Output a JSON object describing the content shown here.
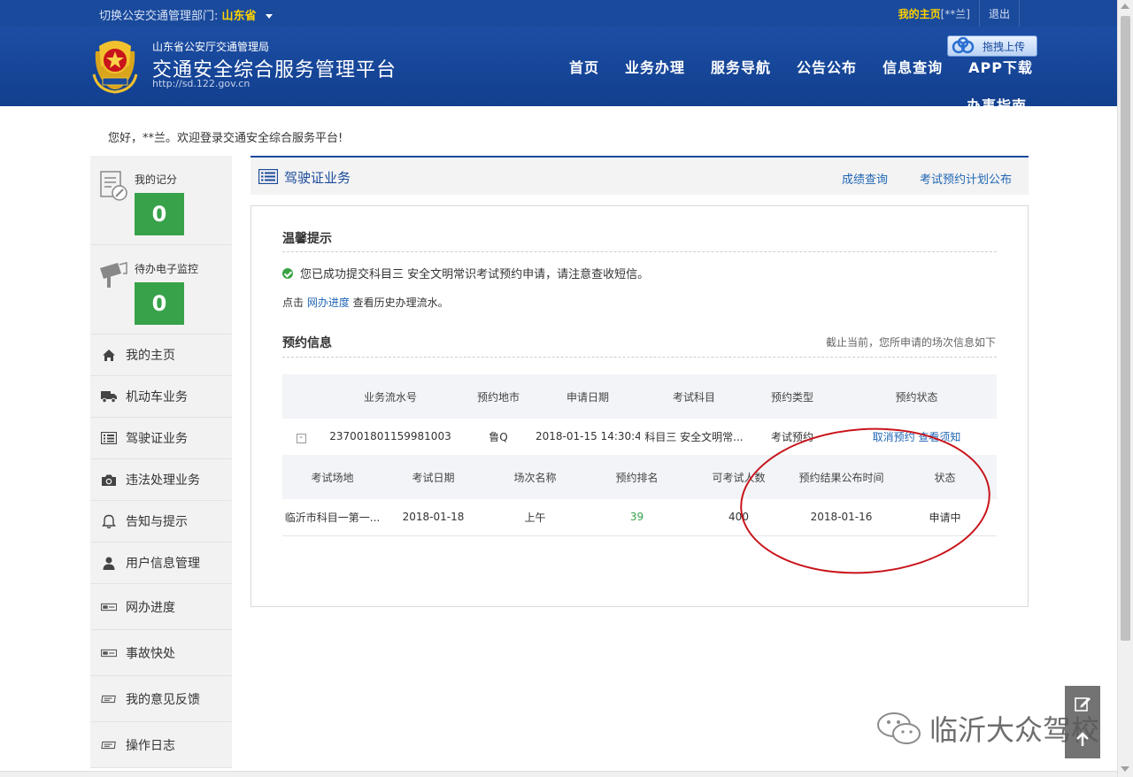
{
  "topbar": {
    "switch_label": "切换公安交通管理部门:",
    "province": "山东省",
    "home_link": "我的主页",
    "user": "[**兰]",
    "logout": "退出"
  },
  "header": {
    "org": "山东省公安厅交通管理局",
    "title": "交通安全综合服务管理平台",
    "url": "http://sd.122.gov.cn",
    "upload": "拖拽上传",
    "nav": [
      "首页",
      "业务办理",
      "服务导航",
      "公告公布",
      "信息查询",
      "APP下载"
    ],
    "nav_overflow": "办事指南"
  },
  "greeting": "您好，**兰。欢迎登录交通安全综合服务平台!",
  "sidebar": {
    "stats": [
      {
        "label": "我的记分",
        "value": "0",
        "icon": "license-edit-icon"
      },
      {
        "label": "待办电子监控",
        "value": "0",
        "icon": "camera-monitor-icon"
      }
    ],
    "items": [
      {
        "label": "我的主页",
        "icon": "home-icon"
      },
      {
        "label": "机动车业务",
        "icon": "truck-icon"
      },
      {
        "label": "驾驶证业务",
        "icon": "list-icon"
      },
      {
        "label": "违法处理业务",
        "icon": "camera-icon"
      },
      {
        "label": "告知与提示",
        "icon": "bell-icon"
      },
      {
        "label": "用户信息管理",
        "icon": "user-icon"
      },
      {
        "label": "网办进度",
        "icon": "progress-icon"
      },
      {
        "label": "事故快处",
        "icon": "accident-icon"
      },
      {
        "label": "我的意见反馈",
        "icon": "feedback-icon"
      },
      {
        "label": "操作日志",
        "icon": "log-icon"
      }
    ]
  },
  "biz": {
    "title": "驾驶证业务",
    "link1": "成绩查询",
    "link2": "考试预约计划公布"
  },
  "tip": {
    "heading": "温馨提示",
    "success": "您已成功提交科目三 安全文明常识考试预约申请，请注意查收短信。",
    "history_pre": "点击 ",
    "history_link": "网办进度",
    "history_post": " 查看历史办理流水。"
  },
  "booking": {
    "heading": "预约信息",
    "note": "截止当前，您所申请的场次信息如下",
    "headers": [
      "业务流水号",
      "预约地市",
      "申请日期",
      "考试科目",
      "预约类型",
      "预约状态"
    ],
    "row": {
      "expand": "-",
      "serial": "237001801159981003",
      "city": "鲁Q",
      "date": "2018-01-15 14:30:44",
      "subject": "科目三 安全文明常...",
      "type": "考试预约",
      "cancel": "取消预约",
      "notice": "查看须知"
    },
    "sub_headers": [
      "考试场地",
      "考试日期",
      "场次名称",
      "预约排名",
      "可考试人数",
      "预约结果公布时间",
      "状态"
    ],
    "sub_row": {
      "venue": "临沂市科目一第一...",
      "exam_date": "2018-01-18",
      "session": "上午",
      "rank": "39",
      "capacity": "400",
      "publish": "2018-01-16",
      "status": "申请中"
    }
  },
  "watermark": "临沂大众驾校"
}
